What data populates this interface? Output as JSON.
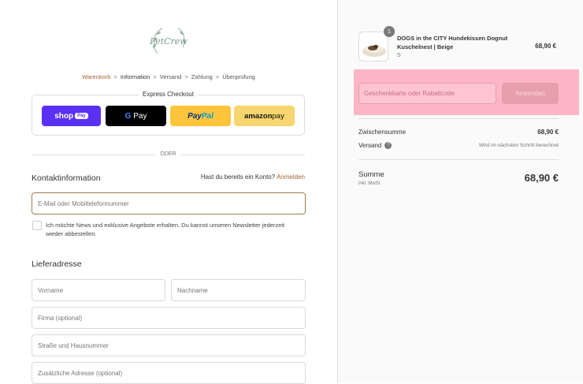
{
  "logo": {
    "text": "PetCrew"
  },
  "breadcrumb": {
    "items": [
      {
        "label": "Warenkorb",
        "state": "link"
      },
      {
        "label": "Information",
        "state": "current"
      },
      {
        "label": "Versand",
        "state": "upcoming"
      },
      {
        "label": "Zahlung",
        "state": "upcoming"
      },
      {
        "label": "Überprüfung",
        "state": "upcoming"
      }
    ]
  },
  "express": {
    "title": "Express Checkout",
    "shop_pay": {
      "label": "shop",
      "tag": "Pay"
    },
    "google_pay": {
      "g": "G",
      "label": "Pay"
    },
    "paypal": {
      "pay": "Pay",
      "pal": "Pal"
    },
    "amazon_pay": {
      "amazon": "amazon",
      "pay": " pay"
    }
  },
  "or_text": "ODER",
  "contact": {
    "title": "Kontaktinformation",
    "login_prompt": "Hast du bereits ein Konto?",
    "login_link": "Anmelden",
    "email_placeholder": "E-Mail oder Mobiltelefonnummer",
    "newsletter_label": "Ich möchte News und exklusive Angebote erhalten. Du kannst unseren Newsletter jederzeit wieder abbestellen."
  },
  "shipping": {
    "title": "Lieferadresse",
    "first_name_placeholder": "Vorname",
    "last_name_placeholder": "Nachname",
    "company_placeholder": "Firma (optional)",
    "street_placeholder": "Straße und Hausnummer",
    "address2_placeholder": "Zusätzliche Adresse (optional)"
  },
  "summary": {
    "product": {
      "quantity": "1",
      "name": "DOGS in the CITY Hundekissen Dognut Kuschelnest | Beige",
      "variant": "S",
      "price": "68,90 €"
    },
    "discount": {
      "placeholder": "Geschenkkarte oder Rabattcode",
      "apply_label": "Anwenden"
    },
    "subtotal_label": "Zwischensumme",
    "subtotal_value": "68,90 €",
    "shipping_label": "Versand",
    "shipping_note": "Wird im nächsten Schritt berechnet",
    "total_label": "Summe",
    "total_sub": "inkl. MwSt.",
    "total_value": "68,90 €"
  },
  "colors": {
    "accent": "#a0652f",
    "shop_pay": "#5a31f4",
    "paypal": "#ffc439",
    "amazon": "#f7d66f",
    "highlight": "#ffb3c4"
  }
}
